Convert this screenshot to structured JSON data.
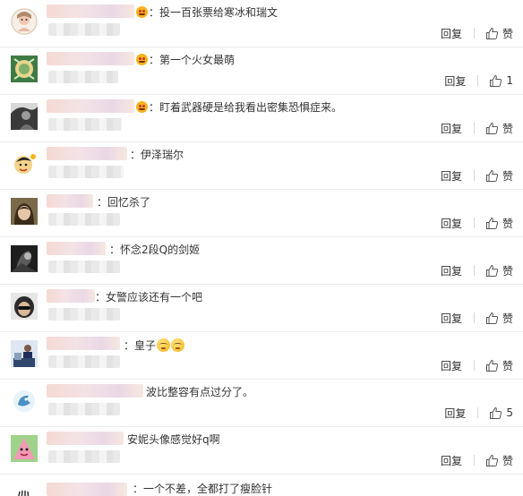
{
  "comments": [
    {
      "text": "投一百张票给寒冰和瑞文",
      "reply_label": "回复",
      "like_label": "赞",
      "emoji": false
    },
    {
      "text": "第一个火女最萌",
      "reply_label": "回复",
      "like_label": "1",
      "emoji": false
    },
    {
      "text": "盯着武器硬是给我看出密集恐惧症来。",
      "reply_label": "回复",
      "like_label": "赞",
      "emoji": false
    },
    {
      "text": "伊泽瑞尔",
      "reply_label": "回复",
      "like_label": "赞",
      "emoji": false
    },
    {
      "text": "回忆杀了",
      "reply_label": "回复",
      "like_label": "赞",
      "emoji": false
    },
    {
      "text": "怀念2段Q的剑姬",
      "reply_label": "回复",
      "like_label": "赞",
      "emoji": false
    },
    {
      "text": "女警应该还有一个吧",
      "reply_label": "回复",
      "like_label": "赞",
      "emoji": false
    },
    {
      "text": "皇子",
      "reply_label": "回复",
      "like_label": "赞",
      "emoji": true
    },
    {
      "text": "波比整容有点过分了。",
      "reply_label": "回复",
      "like_label": "5",
      "emoji": false
    },
    {
      "text": "安妮头像感觉好q啊",
      "reply_label": "回复",
      "like_label": "赞",
      "emoji": false
    },
    {
      "text": "一个不差，全都打了瘦脸针",
      "reply_label": "",
      "like_label": "",
      "emoji": false
    }
  ],
  "colors": {
    "text": "#333333",
    "divider": "#ececec",
    "badge": "#f6b31b"
  },
  "icons": {
    "like": "thumbs-up-icon",
    "badge": "emoji-badge-icon",
    "emoji": "smiley-emoji-icon"
  }
}
